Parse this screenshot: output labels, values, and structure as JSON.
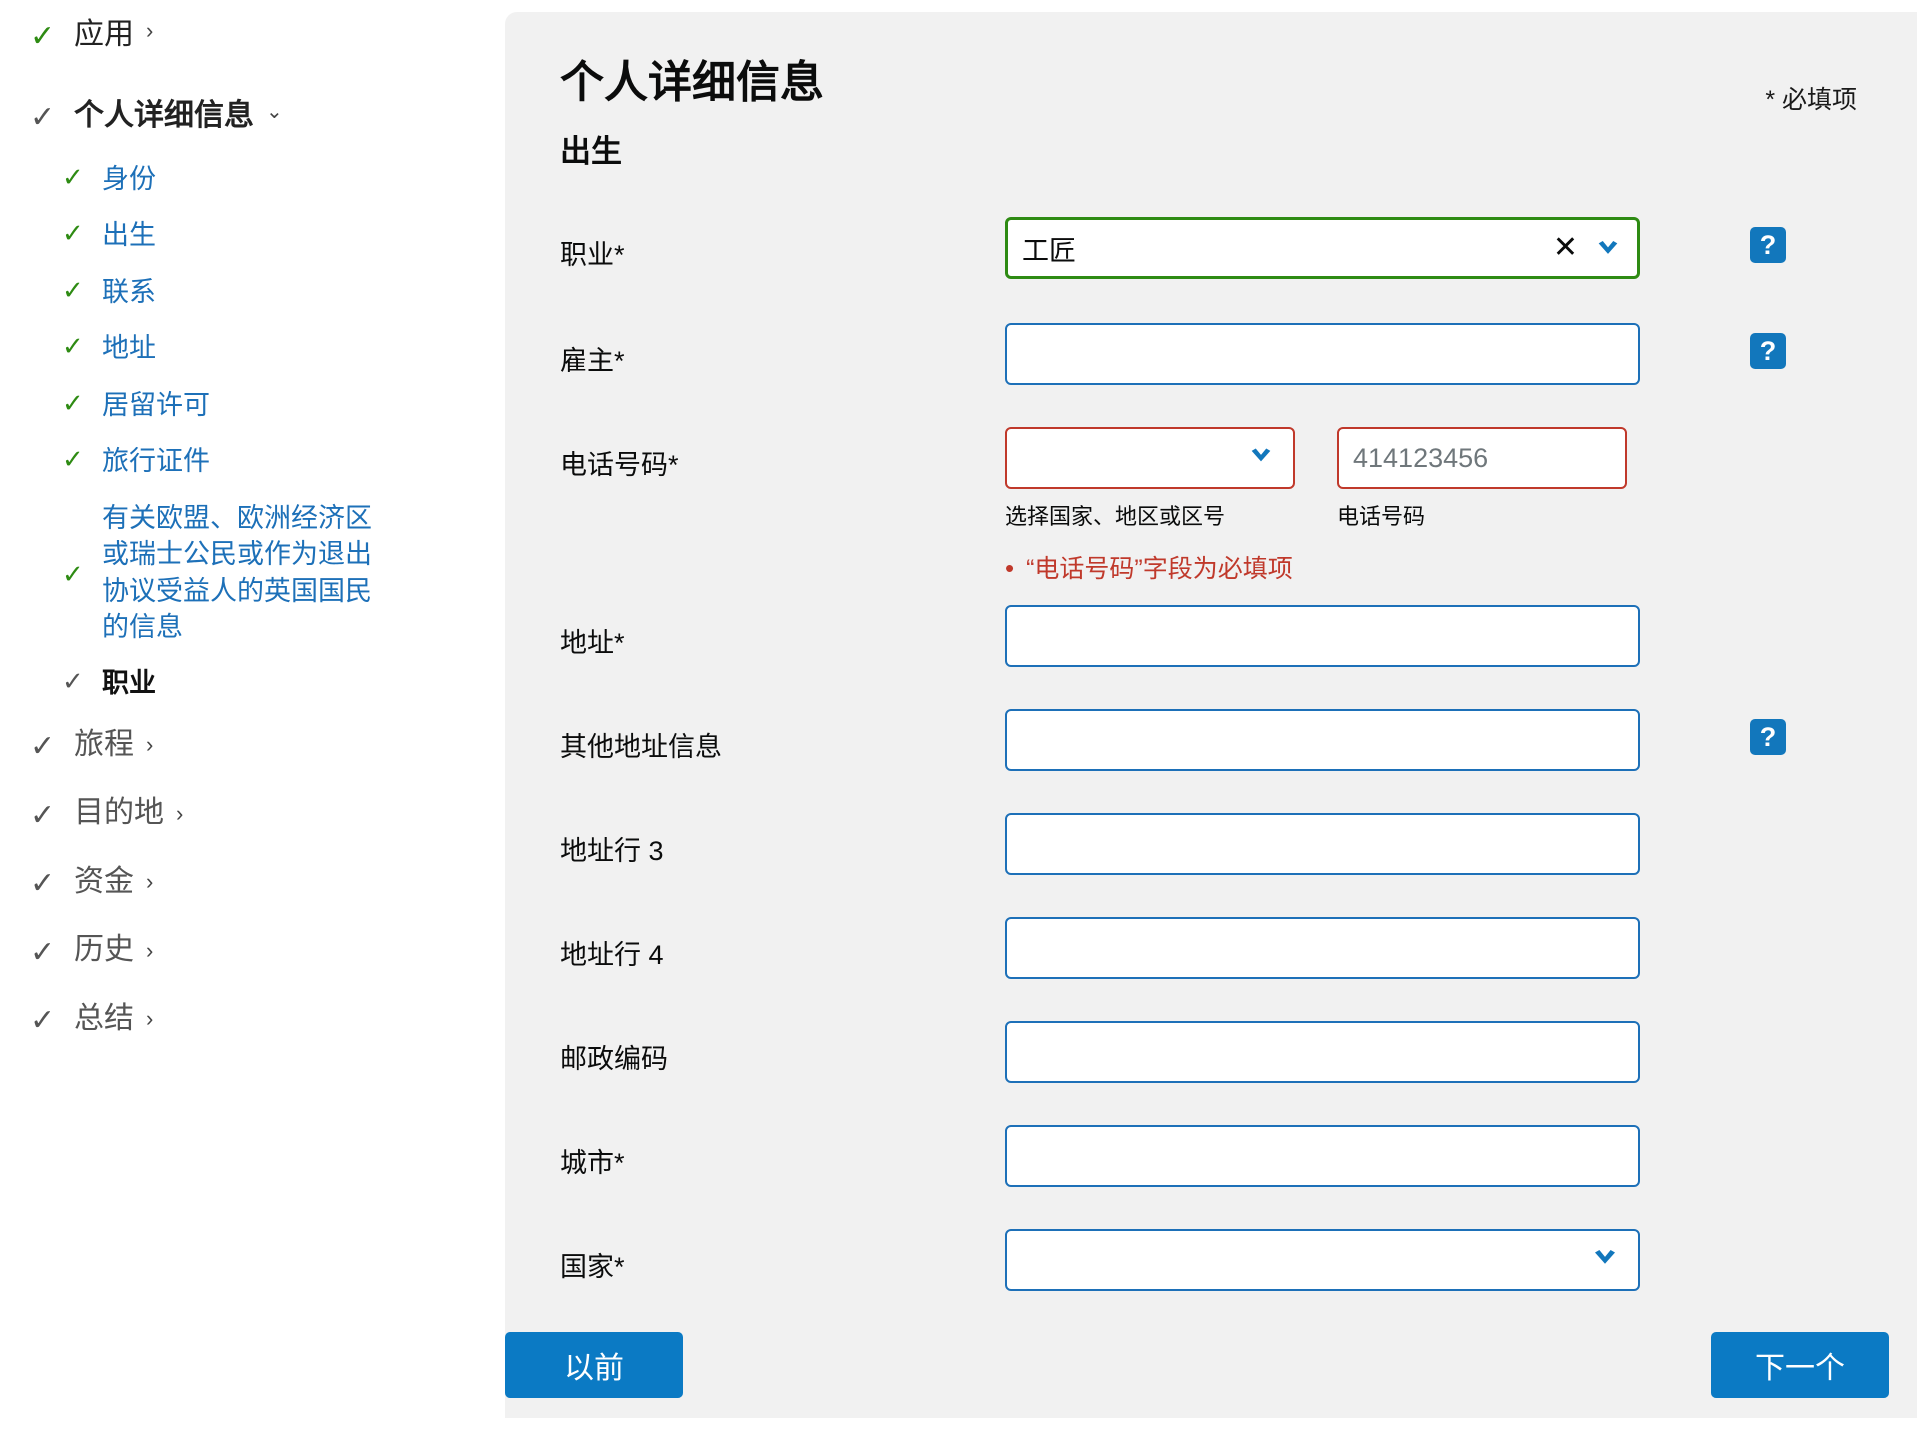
{
  "sidebar": {
    "sections": [
      {
        "label": "应用",
        "state": "complete",
        "check": "green",
        "caret": "right",
        "bold": false
      },
      {
        "label": "个人详细信息",
        "state": "current",
        "check": "grey",
        "caret": "down",
        "bold": true
      }
    ],
    "personal_details_subitems": [
      {
        "label": "身份",
        "check": "green",
        "current": false
      },
      {
        "label": "出生",
        "check": "green",
        "current": false
      },
      {
        "label": "联系",
        "check": "green",
        "current": false
      },
      {
        "label": "地址",
        "check": "green",
        "current": false
      },
      {
        "label": "居留许可",
        "check": "green",
        "current": false
      },
      {
        "label": "旅行证件",
        "check": "green",
        "current": false
      },
      {
        "label": "有关欧盟、欧洲经济区或瑞士公民或作为退出协议受益人的英国国民的信息",
        "check": "green",
        "current": false
      },
      {
        "label": "职业",
        "check": "grey",
        "current": true
      }
    ],
    "bottom_sections": [
      {
        "label": "旅程",
        "check": "grey",
        "caret": "right"
      },
      {
        "label": "目的地",
        "check": "grey",
        "caret": "right"
      },
      {
        "label": "资金",
        "check": "grey",
        "caret": "right"
      },
      {
        "label": "历史",
        "check": "grey",
        "caret": "right"
      },
      {
        "label": "总结",
        "check": "grey",
        "caret": "right"
      }
    ]
  },
  "main": {
    "title": "个人详细信息",
    "subtitle": "出生",
    "required_note": "* 必填项",
    "occupation": {
      "label": "职业*",
      "value": "工匠",
      "clear_icon": "close-icon",
      "dropdown_icon": "chevron-down-icon",
      "help": "?"
    },
    "employer": {
      "label": "雇主*",
      "value": "",
      "placeholder": "",
      "help": "?"
    },
    "phone": {
      "label": "电话号码*",
      "country_value": "",
      "country_hint": "选择国家、地区或区号",
      "number_placeholder": "414123456",
      "number_value": "",
      "number_hint": "电话号码",
      "error": "“电话号码”字段为必填项"
    },
    "address": {
      "label": "地址*",
      "value": ""
    },
    "address_other": {
      "label": "其他地址信息",
      "value": "",
      "help": "?"
    },
    "address_line3": {
      "label": "地址行 3",
      "value": ""
    },
    "address_line4": {
      "label": "地址行 4",
      "value": ""
    },
    "postcode": {
      "label": "邮政编码",
      "value": ""
    },
    "city": {
      "label": "城市*",
      "value": ""
    },
    "country": {
      "label": "国家*",
      "value": "",
      "dropdown_icon": "chevron-down-icon"
    }
  },
  "footer": {
    "previous_label": "以前",
    "next_label": "下一个"
  },
  "colors": {
    "accent_blue": "#1d70b8",
    "button_blue": "#0b7ac4",
    "valid_green": "#2e8b13",
    "error_red": "#c0392b",
    "help_blue": "#1277bc",
    "panel_bg": "#f1f1f1"
  }
}
